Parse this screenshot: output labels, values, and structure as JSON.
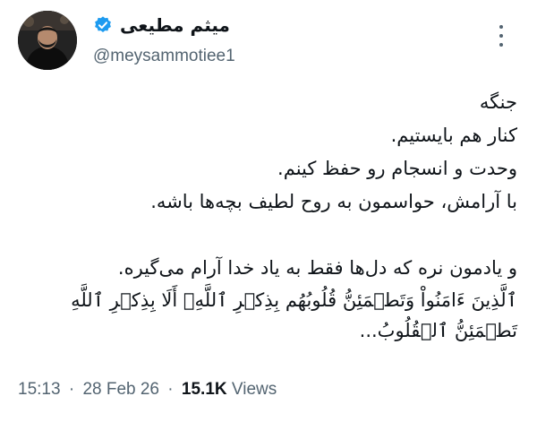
{
  "author": {
    "display_name": "میثم مطیعی",
    "handle": "@meysammotiee1",
    "verified": true,
    "verified_badge_color": "#1d9bf0"
  },
  "tweet": {
    "lines": [
      "جنگه",
      "کنار هم بایستیم.",
      "وحدت و انسجام رو حفظ کینم.",
      "با آرامش، حواسمون به روح لطیف بچه‌ها باشه.",
      "",
      "و یادمون نره که دل‌ها فقط به یاد خدا آرام می‌گیره.",
      "ٱلَّذِينَ ءَامَنُواْ وَتَطۡمَئِنُّ قُلُوبُهُم بِذِكۡرِ ٱللَّهِۗ أَلَا بِذِكۡرِ ٱللَّهِ تَطۡمَئِنُّ ٱلۡقُلُوبُ..."
    ]
  },
  "meta": {
    "time": "15:13",
    "separator": "·",
    "date": "28 Feb 26",
    "views_count": "15.1K",
    "views_label": "Views"
  },
  "icons": {
    "more": "more-icon",
    "verified": "verified-badge-icon",
    "avatar": "avatar"
  }
}
